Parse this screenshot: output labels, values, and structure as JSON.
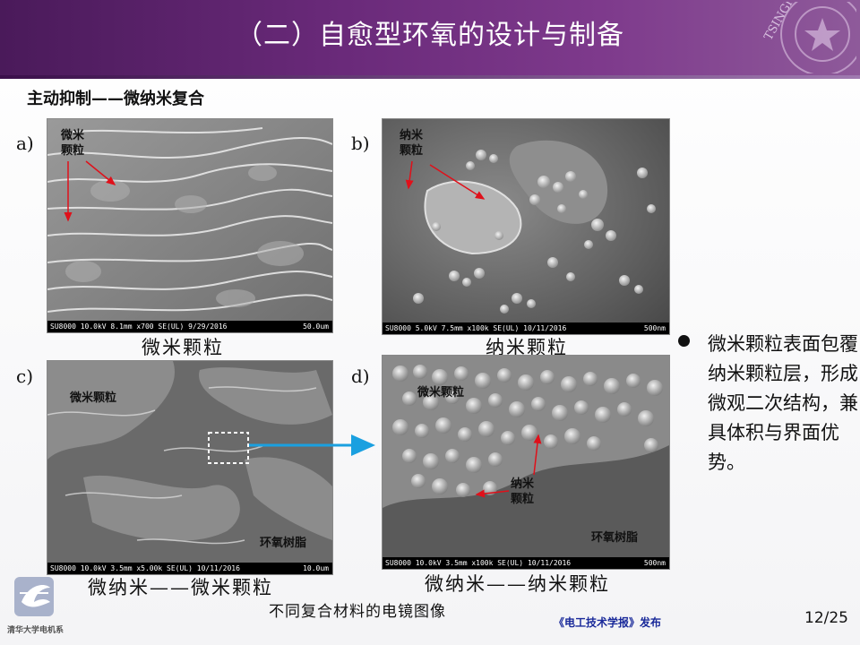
{
  "header": {
    "title": "（二）自愈型环氧的设计与制备",
    "logo_text": "TSINGHUA",
    "banner_color": "#6a2a7a"
  },
  "subtitle": "主动抑制——微纳米复合",
  "panels": {
    "a": {
      "letter": "a)",
      "ann": [
        "微米",
        "颗粒"
      ],
      "bar_left": "SU8000 10.0kV 8.1mm x700 SE(UL) 9/29/2016",
      "bar_right": "50.0um",
      "caption": "微米颗粒"
    },
    "b": {
      "letter": "b)",
      "ann": [
        "纳米",
        "颗粒"
      ],
      "bar_left": "SU8000 5.0kV 7.5mm x100k SE(UL) 10/11/2016",
      "bar_right": "500nm",
      "caption": "纳米颗粒"
    },
    "c": {
      "letter": "c)",
      "ann": [
        "微米颗粒"
      ],
      "ann2": "环氧树脂",
      "bar_left": "SU8000 10.0kV 3.5mm x5.00k SE(UL) 10/11/2016",
      "bar_right": "10.0um",
      "caption": "微纳米——微米颗粒"
    },
    "d": {
      "letter": "d)",
      "ann": [
        "微米颗粒"
      ],
      "ann_nano": [
        "纳米",
        "颗粒"
      ],
      "ann2": "环氧树脂",
      "bar_left": "SU8000 10.0kV 3.5mm x100k SE(UL) 10/11/2016",
      "bar_right": "500nm",
      "caption": "微纳米——纳米颗粒"
    }
  },
  "figure_caption": "不同复合材料的电镜图像",
  "bullet": "微米颗粒表面包覆纳米颗粒层，形成微观二次结构，兼具体积与界面优势。",
  "footer": {
    "brand": "清华大学电机系",
    "journal": "《电工技术学报》发布",
    "page": "12/25"
  },
  "colors": {
    "arrow_red": "#e0101a",
    "connector_blue": "#1aa0e0",
    "journal_blue": "#1a2a9a"
  }
}
